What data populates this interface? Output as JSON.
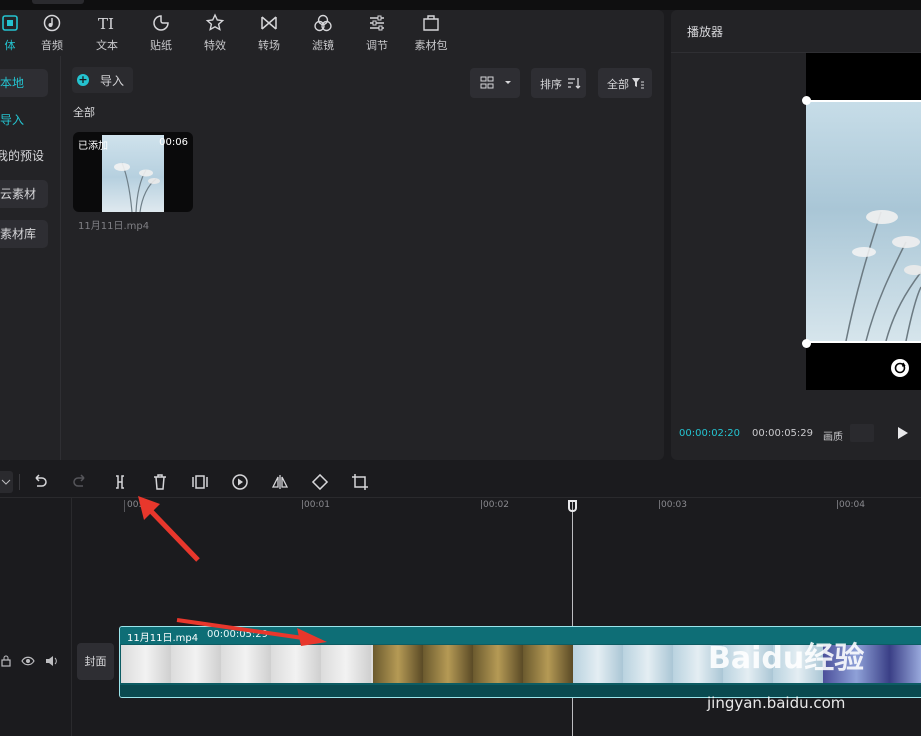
{
  "toolbar": {
    "items": [
      {
        "label": "体",
        "icon": "media-icon"
      },
      {
        "label": "音频",
        "icon": "audio-icon"
      },
      {
        "label": "文本",
        "icon": "text-icon"
      },
      {
        "label": "贴纸",
        "icon": "sticker-icon"
      },
      {
        "label": "特效",
        "icon": "effects-icon"
      },
      {
        "label": "转场",
        "icon": "transition-icon"
      },
      {
        "label": "滤镜",
        "icon": "filter-icon"
      },
      {
        "label": "调节",
        "icon": "adjust-icon"
      },
      {
        "label": "素材包",
        "icon": "package-icon"
      }
    ]
  },
  "sidebar": {
    "items": [
      {
        "label": "本地"
      },
      {
        "label": "导入"
      },
      {
        "label": "我的预设"
      },
      {
        "label": "云素材"
      },
      {
        "label": "素材库"
      }
    ]
  },
  "media": {
    "import_label": "导入",
    "sort_label": "排序",
    "filter_label": "全部",
    "section_label": "全部",
    "clip": {
      "added_badge": "已添加",
      "duration": "00:06",
      "name": "11月11日.mp4"
    }
  },
  "player": {
    "title": "播放器",
    "current_time": "00:00:02:20",
    "total_time": "00:00:05:29",
    "quality_label": "画质"
  },
  "timeline": {
    "ruler": [
      "00:0",
      "|00:01",
      "|00:02",
      "|00:03",
      "|00:04"
    ],
    "cover_label": "封面",
    "track": {
      "name": "11月11日.mp4",
      "duration": "00:00:05:29"
    }
  },
  "watermark": {
    "brand": "Baidu经验",
    "url": "jingyan.baidu.com"
  },
  "colors": {
    "accent": "#24c3d0",
    "track": "#0d5c63",
    "annotation_arrow": "#e8372c"
  }
}
